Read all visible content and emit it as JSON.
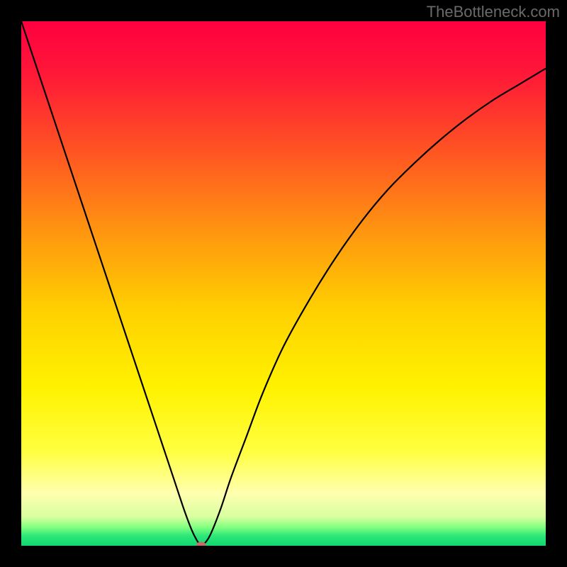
{
  "watermark": "TheBottleneck.com",
  "chart_data": {
    "type": "line",
    "title": "",
    "xlabel": "",
    "ylabel": "",
    "xlim": [
      0,
      100
    ],
    "ylim": [
      0,
      100
    ],
    "grid": false,
    "background_gradient": {
      "stops": [
        {
          "offset": 0.0,
          "color": "#ff0040"
        },
        {
          "offset": 0.1,
          "color": "#ff1838"
        },
        {
          "offset": 0.25,
          "color": "#ff5522"
        },
        {
          "offset": 0.4,
          "color": "#ff9510"
        },
        {
          "offset": 0.55,
          "color": "#ffd000"
        },
        {
          "offset": 0.7,
          "color": "#fff200"
        },
        {
          "offset": 0.82,
          "color": "#ffff40"
        },
        {
          "offset": 0.9,
          "color": "#ffffb0"
        },
        {
          "offset": 0.945,
          "color": "#d8ffa0"
        },
        {
          "offset": 0.965,
          "color": "#80ff80"
        },
        {
          "offset": 0.98,
          "color": "#30e878"
        },
        {
          "offset": 1.0,
          "color": "#10d870"
        }
      ]
    },
    "series": [
      {
        "name": "bottleneck-curve",
        "color": "#000000",
        "stroke_width": 2.2,
        "x": [
          0,
          2,
          5,
          8,
          11,
          14,
          17,
          20,
          23,
          26,
          29,
          31,
          32.5,
          33.5,
          34,
          34.3,
          34.8,
          36,
          38,
          40,
          43,
          46,
          50,
          55,
          60,
          65,
          70,
          75,
          80,
          85,
          90,
          95,
          100
        ],
        "y": [
          100,
          94,
          85,
          76,
          67,
          58,
          49,
          40,
          31,
          22,
          13,
          7,
          3,
          1,
          0.3,
          0.2,
          0.3,
          2,
          7,
          13,
          21,
          29,
          38,
          47,
          55,
          62,
          68,
          73,
          77.5,
          81.5,
          85,
          88,
          91
        ]
      }
    ],
    "marker": {
      "name": "minimum-point",
      "x": 34.3,
      "y": 0.2,
      "rx": 0.9,
      "ry": 0.55,
      "color": "#c96a6a"
    }
  }
}
